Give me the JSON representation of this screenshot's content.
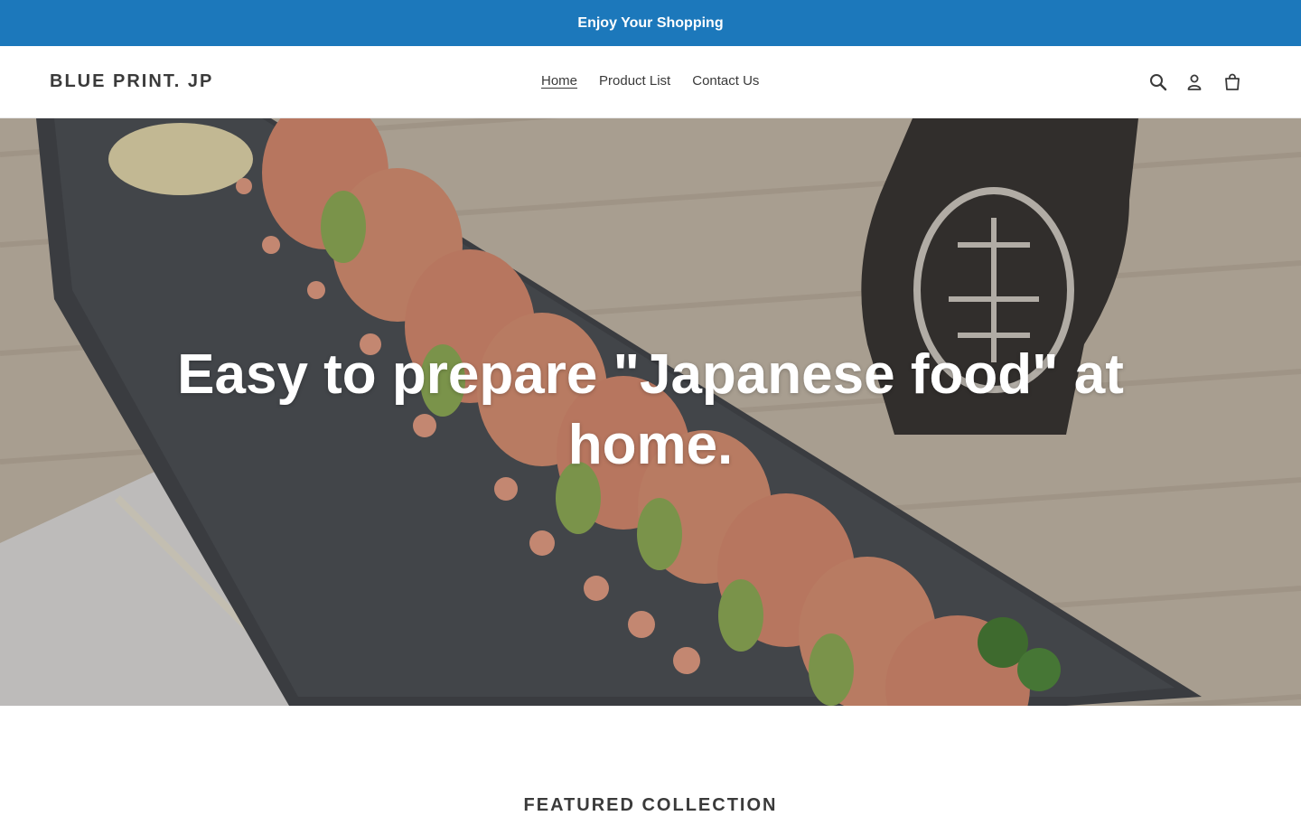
{
  "announcement": {
    "text": "Enjoy Your Shopping"
  },
  "header": {
    "logo": "BLUE PRINT. JP",
    "nav": [
      {
        "label": "Home",
        "active": true
      },
      {
        "label": "Product List",
        "active": false
      },
      {
        "label": "Contact Us",
        "active": false
      }
    ],
    "icons": [
      "search-icon",
      "account-icon",
      "cart-icon"
    ]
  },
  "hero": {
    "headline": "Easy to prepare \"Japanese food\" at home.",
    "image_subject": "sushi roll on dark slate plate with sake bottle and chopsticks"
  },
  "featured": {
    "title": "FEATURED COLLECTION"
  },
  "colors": {
    "announcement_bg": "#1c78bb",
    "text": "#3a3a3a",
    "white": "#ffffff"
  }
}
